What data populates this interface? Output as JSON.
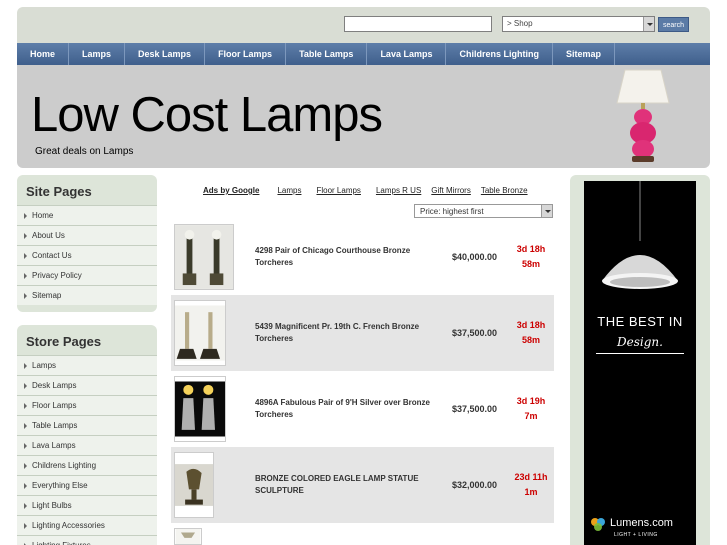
{
  "search": {
    "placeholder": "",
    "shop_value": "> Shop",
    "button_label": "search"
  },
  "nav": [
    "Home",
    "Lamps",
    "Desk Lamps",
    "Floor Lamps",
    "Table Lamps",
    "Lava Lamps",
    "Childrens Lighting",
    "Sitemap"
  ],
  "header": {
    "title": "Low Cost Lamps",
    "tagline": "Great deals on Lamps"
  },
  "site_pages": {
    "heading": "Site Pages",
    "items": [
      "Home",
      "About Us",
      "Contact Us",
      "Privacy Policy",
      "Sitemap"
    ]
  },
  "store_pages": {
    "heading": "Store Pages",
    "items": [
      "Lamps",
      "Desk Lamps",
      "Floor Lamps",
      "Table Lamps",
      "Lava Lamps",
      "Childrens Lighting",
      "Everything Else",
      "Light Bulbs",
      "Lighting Accessories",
      "Lighting Fixtures"
    ]
  },
  "ad_links": [
    "Ads by Google",
    "Lamps",
    "Floor Lamps",
    "Lamps R US",
    "Gift Mirrors",
    "Table Bronze"
  ],
  "sort": {
    "value": "Price: highest first"
  },
  "listings": [
    {
      "name": "4298 Pair of Chicago Courthouse Bronze Torcheres",
      "price": "$40,000.00",
      "time_line1": "3d 18h",
      "time_line2": "58m"
    },
    {
      "name": "5439 Magnificent Pr. 19th C. French Bronze Torcheres",
      "price": "$37,500.00",
      "time_line1": "3d 18h",
      "time_line2": "58m"
    },
    {
      "name": "4896A Fabulous Pair of 9'H Silver over Bronze Torcheres",
      "price": "$37,500.00",
      "time_line1": "3d 19h",
      "time_line2": "7m"
    },
    {
      "name": "BRONZE COLORED EAGLE LAMP STATUE SCULPTURE",
      "price": "$32,000.00",
      "time_line1": "23d 11h",
      "time_line2": "1m"
    }
  ],
  "advert": {
    "headline": "THE BEST IN",
    "subline": "Design.",
    "brand": "Lumens.com",
    "brand_sub": "LIGHT + LIVING"
  },
  "colors": {
    "nav_blue": "#4a6a98",
    "sidebar_green": "#dde5d9",
    "header_gray": "#cccccc",
    "time_red": "#cc0000"
  }
}
